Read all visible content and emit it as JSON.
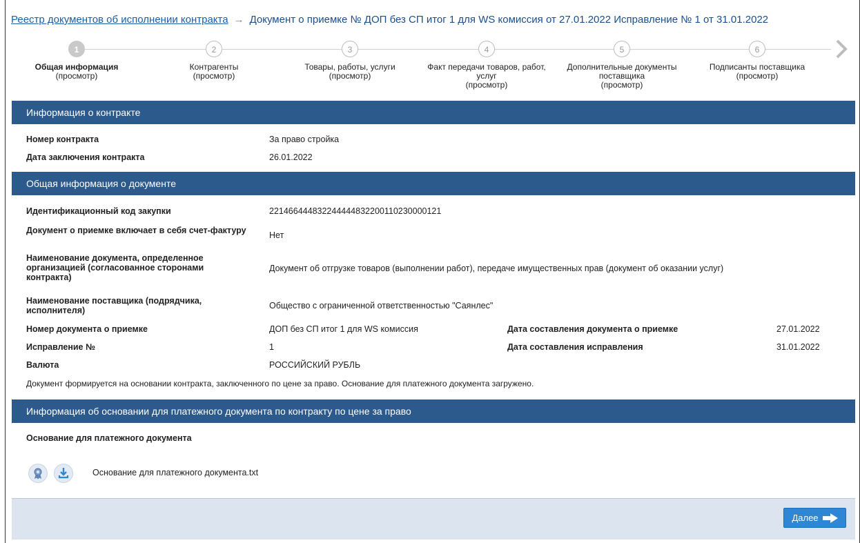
{
  "breadcrumb": {
    "link": "Реестр документов об исполнении контракта",
    "arrow": "→",
    "current": "Документ о приемке № ДОП без СП итог 1 для WS комиссия от 27.01.2022 Исправление № 1 от 31.01.2022"
  },
  "steps": [
    {
      "num": "1",
      "title": "Общая информация",
      "sub": "(просмотр)",
      "active": true
    },
    {
      "num": "2",
      "title": "Контрагенты",
      "sub": "(просмотр)",
      "active": false
    },
    {
      "num": "3",
      "title": "Товары, работы, услуги",
      "sub": "(просмотр)",
      "active": false
    },
    {
      "num": "4",
      "title": "Факт передачи товаров, работ,",
      "title2": "услуг",
      "sub": "(просмотр)",
      "active": false
    },
    {
      "num": "5",
      "title": "Дополнительные документы",
      "title2": "поставщика",
      "sub": "(просмотр)",
      "active": false
    },
    {
      "num": "6",
      "title": "Подписанты поставщика",
      "sub": "(просмотр)",
      "active": false
    }
  ],
  "contract": {
    "header": "Информация о контракте",
    "number_label": "Номер контракта",
    "number_value": "За право стройка",
    "date_label": "Дата заключения контракта",
    "date_value": "26.01.2022"
  },
  "doc_info": {
    "header": "Общая информация о документе",
    "ikz_label": "Идентификационный код закупки",
    "ikz_value": "221466444832244444832200110230000121",
    "invoice_label": "Документ о приемке включает в себя счет-фактуру",
    "invoice_value": "Нет",
    "docname_label": "Наименование документа, определенное организацией (согласованное сторонами контракта)",
    "docname_value": "Документ об отгрузке товаров (выполнении работ), передаче имущественных прав (документ об оказании услуг)",
    "supplier_label": "Наименование поставщика (подрядчика, исполнителя)",
    "supplier_value": "Общество с ограниченной ответственностью \"Саянлес\"",
    "docnum_label": "Номер документа о приемке",
    "docnum_value": "ДОП без СП итог 1 для WS комиссия",
    "docdate_label": "Дата составления документа о приемке",
    "docdate_value": "27.01.2022",
    "fix_label": "Исправление №",
    "fix_value": "1",
    "fixdate_label": "Дата составления исправления",
    "fixdate_value": "31.01.2022",
    "currency_label": "Валюта",
    "currency_value": "РОССИЙСКИЙ РУБЛЬ",
    "note": "Документ формируется на основании контракта, заключенного по цене за право. Основание для платежного документа загружено."
  },
  "payment": {
    "header": "Информация об основании для платежного документа по контракту по цене за право",
    "label": "Основание для платежного документа",
    "file_name": "Основание для платежного документа.txt",
    "icons": [
      "certificate-icon",
      "download-icon"
    ]
  },
  "footer": {
    "next_label": "Далее"
  },
  "colors": {
    "header_bg": "#2c5a8c",
    "link": "#1a5fa8",
    "button": "#2e86d4",
    "footer_bg": "#dce5ef"
  }
}
